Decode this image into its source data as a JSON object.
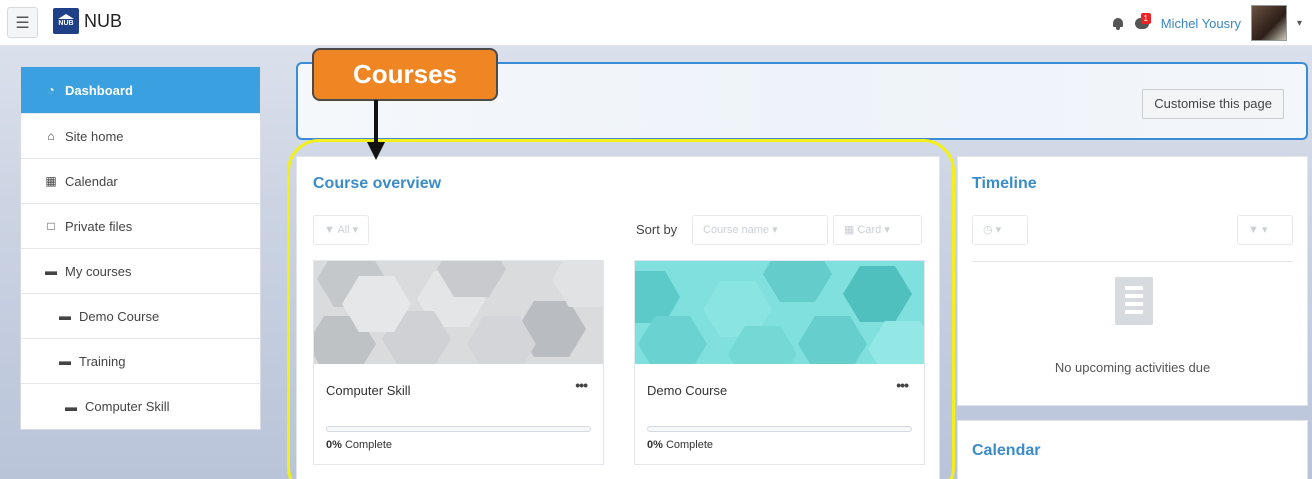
{
  "navbar": {
    "menu_icon": "hamburger-icon",
    "brand_logo_text": "NUB",
    "brand_name": "NUB",
    "notification_icon": "bell-icon",
    "messages_icon": "chat-bubble-icon",
    "messages_badge": "1",
    "user_name": "Michel Yousry",
    "user_caret": "▾"
  },
  "sidebar": {
    "items": [
      {
        "label": "Dashboard",
        "icon": "dashboard-icon",
        "glyph": "◔",
        "active": true
      },
      {
        "label": "Site home",
        "icon": "home-icon",
        "glyph": "⌂"
      },
      {
        "label": "Calendar",
        "icon": "calendar-icon",
        "glyph": "▦"
      },
      {
        "label": "Private files",
        "icon": "file-icon",
        "glyph": "□"
      },
      {
        "label": "My courses",
        "icon": "graduation-cap-icon",
        "glyph": "▬"
      },
      {
        "label": "Demo Course",
        "icon": "graduation-cap-icon",
        "glyph": "▬"
      },
      {
        "label": "Training",
        "icon": "graduation-cap-icon",
        "glyph": "▬"
      },
      {
        "label": "Computer Skill",
        "icon": "graduation-cap-icon",
        "glyph": "▬"
      }
    ]
  },
  "header": {
    "customise_label": "Customise this page"
  },
  "callout": {
    "label": "Courses"
  },
  "course_overview": {
    "title": "Course overview",
    "filter_label": "▼ All ▾",
    "sort_by_label": "Sort by",
    "sort_value": "Course name ▾",
    "view_value": "▦ Card ▾",
    "courses": [
      {
        "name": "Computer Skill",
        "menu": "•••",
        "progress_value": "0%",
        "progress_suffix": " Complete",
        "progress": 0,
        "image_color": "#c9cccf"
      },
      {
        "name": "Demo Course",
        "menu": "•••",
        "progress_value": "0%",
        "progress_suffix": " Complete",
        "progress": 0,
        "image_color": "#6fd6d4"
      }
    ]
  },
  "timeline": {
    "title": "Timeline",
    "clock_filter": "◷ ▾",
    "sort_filter": "▼ ▾",
    "empty_text": "No upcoming activities due"
  },
  "calendar": {
    "title": "Calendar"
  },
  "colors": {
    "accent": "#3aa0df",
    "title_blue": "#3a8cc9",
    "callout_orange": "#ef8523",
    "highlight_yellow": "#f2ef19"
  }
}
